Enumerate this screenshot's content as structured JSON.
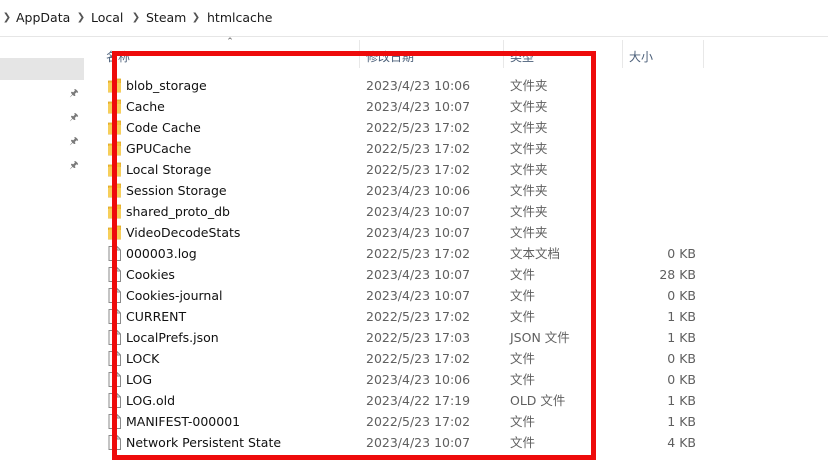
{
  "breadcrumb": [
    "AppData",
    "Local",
    "Steam",
    "htmlcache"
  ],
  "columns": {
    "name": "名称",
    "date": "修改日期",
    "type": "类型",
    "size": "大小"
  },
  "files": [
    {
      "name": "blob_storage",
      "date": "2023/4/23 10:06",
      "type": "文件夹",
      "size": "",
      "icon": "folder-icon"
    },
    {
      "name": "Cache",
      "date": "2023/4/23 10:07",
      "type": "文件夹",
      "size": "",
      "icon": "folder-icon"
    },
    {
      "name": "Code Cache",
      "date": "2022/5/23 17:02",
      "type": "文件夹",
      "size": "",
      "icon": "folder-icon"
    },
    {
      "name": "GPUCache",
      "date": "2022/5/23 17:02",
      "type": "文件夹",
      "size": "",
      "icon": "folder-icon"
    },
    {
      "name": "Local Storage",
      "date": "2022/5/23 17:02",
      "type": "文件夹",
      "size": "",
      "icon": "folder-icon"
    },
    {
      "name": "Session Storage",
      "date": "2023/4/23 10:06",
      "type": "文件夹",
      "size": "",
      "icon": "folder-icon"
    },
    {
      "name": "shared_proto_db",
      "date": "2023/4/23 10:07",
      "type": "文件夹",
      "size": "",
      "icon": "folder-icon"
    },
    {
      "name": "VideoDecodeStats",
      "date": "2023/4/23 10:07",
      "type": "文件夹",
      "size": "",
      "icon": "folder-icon"
    },
    {
      "name": "000003.log",
      "date": "2022/5/23 17:02",
      "type": "文本文档",
      "size": "0 KB",
      "icon": "file-icon"
    },
    {
      "name": "Cookies",
      "date": "2023/4/23 10:07",
      "type": "文件",
      "size": "28 KB",
      "icon": "file-icon"
    },
    {
      "name": "Cookies-journal",
      "date": "2023/4/23 10:07",
      "type": "文件",
      "size": "0 KB",
      "icon": "file-icon"
    },
    {
      "name": "CURRENT",
      "date": "2022/5/23 17:02",
      "type": "文件",
      "size": "1 KB",
      "icon": "file-icon"
    },
    {
      "name": "LocalPrefs.json",
      "date": "2022/5/23 17:03",
      "type": "JSON 文件",
      "size": "1 KB",
      "icon": "file-icon"
    },
    {
      "name": "LOCK",
      "date": "2022/5/23 17:02",
      "type": "文件",
      "size": "0 KB",
      "icon": "file-icon"
    },
    {
      "name": "LOG",
      "date": "2023/4/23 10:06",
      "type": "文件",
      "size": "0 KB",
      "icon": "file-icon"
    },
    {
      "name": "LOG.old",
      "date": "2023/4/22 17:19",
      "type": "OLD 文件",
      "size": "1 KB",
      "icon": "file-icon"
    },
    {
      "name": "MANIFEST-000001",
      "date": "2022/5/23 17:02",
      "type": "文件",
      "size": "1 KB",
      "icon": "file-icon"
    },
    {
      "name": "Network Persistent State",
      "date": "2023/4/23 10:07",
      "type": "文件",
      "size": "4 KB",
      "icon": "file-icon"
    }
  ],
  "colors": {
    "annotation_box": "#ee0b0b",
    "folder_fill": "#f5c343",
    "header_text": "#4c607a"
  }
}
